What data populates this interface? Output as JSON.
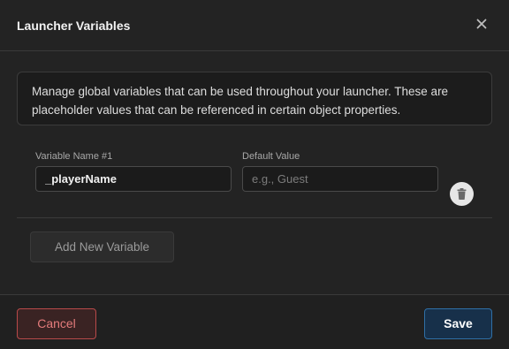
{
  "dialog": {
    "title": "Launcher Variables",
    "close_icon": "close-icon"
  },
  "info": {
    "text": "Manage global variables that can be used throughout your launcher. These are placeholder values that can be referenced in certain object properties."
  },
  "variables": [
    {
      "name_label": "Variable Name #1",
      "name_value": "_playerName",
      "default_label": "Default Value",
      "default_value": "",
      "default_placeholder": "e.g., Guest",
      "delete_icon": "trash-icon"
    }
  ],
  "actions": {
    "add_label": "Add New Variable",
    "cancel_label": "Cancel",
    "save_label": "Save"
  },
  "colors": {
    "background": "#232323",
    "cancel_accent": "#e47b7b",
    "save_accent": "#2f6fa6"
  }
}
